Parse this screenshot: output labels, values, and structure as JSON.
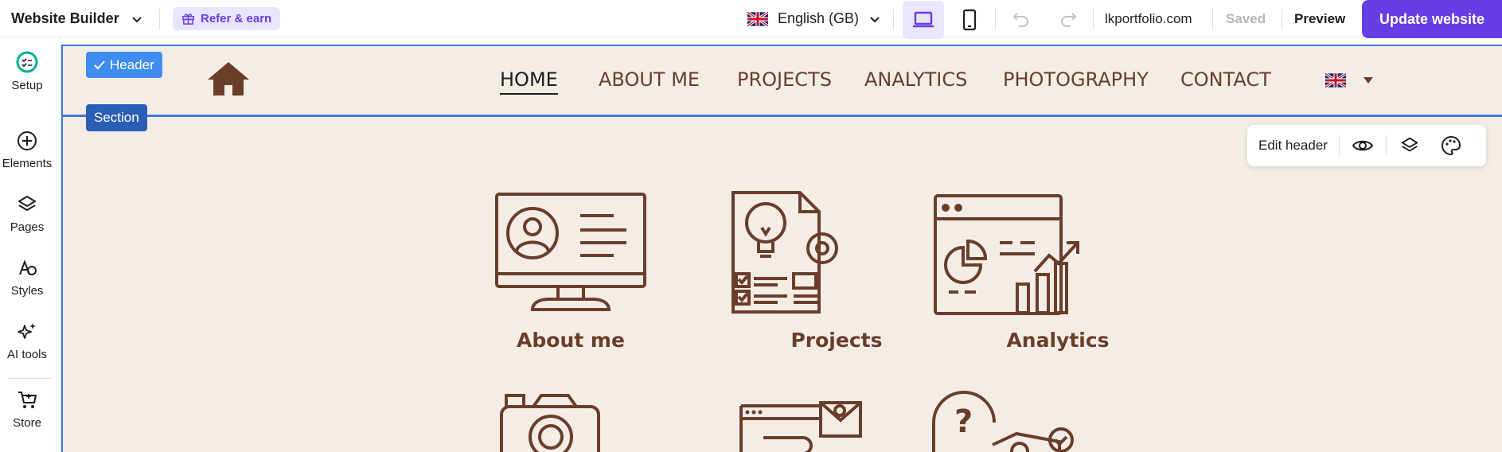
{
  "topbar": {
    "brand": "Website Builder",
    "refer": "Refer & earn",
    "language": "English (GB)",
    "domain": "lkportfolio.com",
    "saved": "Saved",
    "preview": "Preview",
    "update": "Update website"
  },
  "sidebar": {
    "items": [
      {
        "label": "Setup",
        "icon": "setup-checklist-icon"
      },
      {
        "label": "Elements",
        "icon": "plus-circle-icon"
      },
      {
        "label": "Pages",
        "icon": "layers-icon"
      },
      {
        "label": "Styles",
        "icon": "styles-icon"
      },
      {
        "label": "AI tools",
        "icon": "sparkles-icon"
      },
      {
        "label": "Store",
        "icon": "cart-icon"
      }
    ]
  },
  "canvas": {
    "badge_header": "Header",
    "badge_section": "Section",
    "edit_header": "Edit header",
    "nav": [
      "HOME",
      "ABOUT ME",
      "PROJECTS",
      "ANALYTICS",
      "PHOTOGRAPHY",
      "CONTACT"
    ],
    "tiles": [
      "About me",
      "Projects",
      "Analytics"
    ]
  },
  "colors": {
    "accent": "#673de6",
    "canvas_bg": "#f3ede6",
    "brown": "#6b3e2a",
    "selection": "#3f78e0"
  }
}
